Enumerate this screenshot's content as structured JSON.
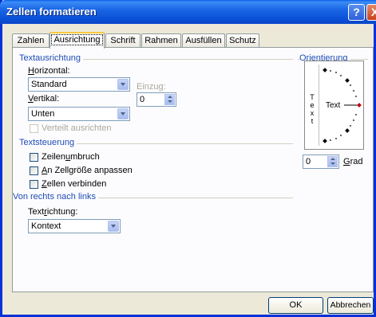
{
  "window": {
    "title": "Zellen formatieren",
    "help": "?",
    "close": "X"
  },
  "tabs": [
    "Zahlen",
    "Ausrichtung",
    "Schrift",
    "Rahmen",
    "Ausfüllen",
    "Schutz"
  ],
  "active_tab": "Ausrichtung",
  "textausrichtung": {
    "group_label": "Textausrichtung",
    "horizontal": {
      "label_u": "H",
      "label_rest": "orizontal:",
      "value": "Standard"
    },
    "einzug": {
      "label": "Einzug:",
      "value": "0"
    },
    "vertikal": {
      "label_u": "V",
      "label_rest": "ertikal:",
      "value": "Unten"
    },
    "verteilt": {
      "label": "Verteilt ausrichten",
      "checked": false,
      "enabled": false
    }
  },
  "textsteuerung": {
    "group_label": "Textsteuerung",
    "zeilenumbruch": {
      "pre": "Zeilen",
      "u": "u",
      "post": "mbruch",
      "checked": false
    },
    "anpassen": {
      "pre": "",
      "u": "A",
      "post": "n Zellgröße anpassen",
      "checked": false
    },
    "verbinden": {
      "pre": "",
      "u": "Z",
      "post": "ellen verbinden",
      "checked": false
    }
  },
  "rtl": {
    "group_label": "Von rechts nach links",
    "textrichtung": {
      "pre": "Text",
      "u": "r",
      "post": "ichtung:",
      "value": "Kontext"
    }
  },
  "orientierung": {
    "group_label": "Orientierung",
    "vertical_text": [
      "T",
      "e",
      "x",
      "t"
    ],
    "dial_text": "Text",
    "grad_value": "0",
    "grad_label_u": "G",
    "grad_label_rest": "rad",
    "angle_degrees": 0,
    "marker_color": "#c00000"
  },
  "buttons": {
    "ok": "OK",
    "cancel": "Abbrechen"
  },
  "colors": {
    "title_blue": "#0a4fd6",
    "group_label": "#1f4bb4",
    "dialog_bg": "#ece9d8"
  }
}
